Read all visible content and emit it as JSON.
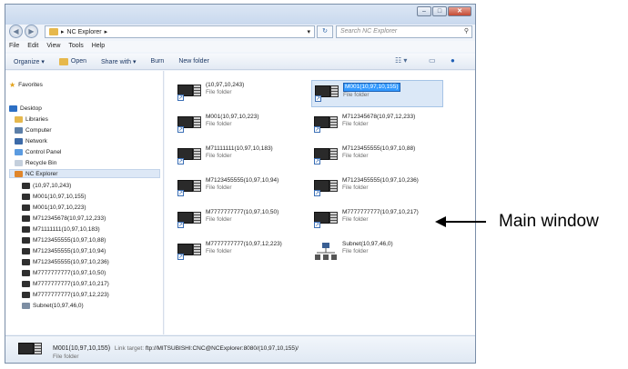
{
  "window": {
    "caption": {
      "minimize": "–",
      "maximize": "□",
      "close": "✕"
    }
  },
  "address": {
    "back_icon": "back-arrow-icon",
    "forward_icon": "forward-arrow-icon",
    "path": "NC Explorer",
    "path_sep": "▸",
    "search_placeholder": "Search NC Explorer"
  },
  "menu": {
    "items": [
      "File",
      "Edit",
      "View",
      "Tools",
      "Help"
    ]
  },
  "toolbar": {
    "organize": "Organize ▾",
    "open": "Open",
    "share_with": "Share with ▾",
    "burn": "Burn",
    "new_folder": "New folder"
  },
  "navpane": {
    "favorites": "Favorites",
    "desktop": "Desktop",
    "libraries": "Libraries",
    "computer": "Computer",
    "network": "Network",
    "control_panel": "Control Panel",
    "recycle_bin": "Recycle Bin",
    "nc_explorer": "NC Explorer",
    "children": [
      "(10,97,10,243)",
      "M001(10,97,10,155)",
      "M001(10,97,10,223)",
      "M712345678(10,97,12,233)",
      "M71111111(10,97,10,183)",
      "M7123455555(10,97,10,88)",
      "M7123455555(10,97,10,94)",
      "M7123455555(10,97,10,236)",
      "M7777777777(10,97,10,50)",
      "M7777777777(10,97,10,217)",
      "M7777777777(10,97,12,223)",
      "Subnet(10,97,46,0)"
    ]
  },
  "items": [
    {
      "name": "(10,97,10,243)",
      "type": "File folder"
    },
    {
      "name": "M001(10,97,10,155)",
      "type": "File folder"
    },
    {
      "name": "M001(10,97,10,223)",
      "type": "File folder"
    },
    {
      "name": "M712345678(10,97,12,233)",
      "type": "File folder"
    },
    {
      "name": "M71111111(10,97,10,183)",
      "type": "File folder"
    },
    {
      "name": "M7123455555(10,97,10,88)",
      "type": "File folder"
    },
    {
      "name": "M7123455555(10,97,10,94)",
      "type": "File folder"
    },
    {
      "name": "M7123455555(10,97,10,236)",
      "type": "File folder"
    },
    {
      "name": "M7777777777(10,97,10,50)",
      "type": "File folder"
    },
    {
      "name": "M7777777777(10,97,10,217)",
      "type": "File folder"
    },
    {
      "name": "M7777777777(10,97,12,223)",
      "type": "File folder"
    },
    {
      "name": "Subnet(10,97,46,0)",
      "type": "File folder"
    }
  ],
  "details": {
    "name": "M001(10,97,10,155)",
    "link_label": "Link target:",
    "link_target": "ftp://MITSUBISHI:CNC@NCExplorer:8080/(10,97,10,155)/",
    "type": "File folder"
  },
  "callout": {
    "label": "Main window"
  }
}
